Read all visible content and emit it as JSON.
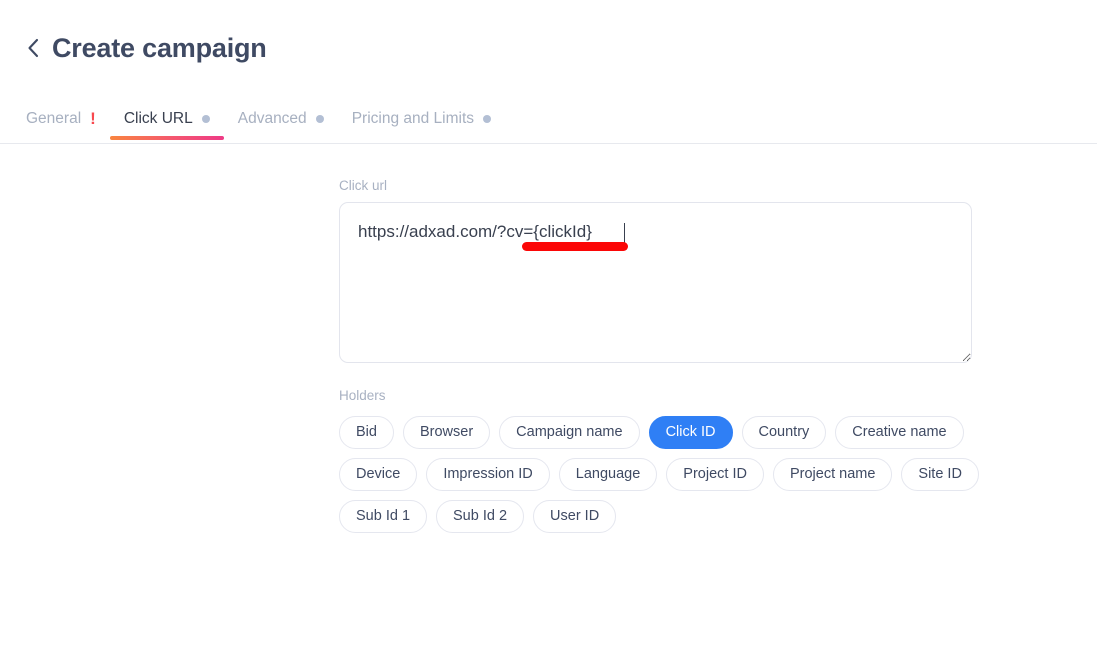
{
  "header": {
    "back_icon": "chevron-left-icon",
    "title": "Create campaign"
  },
  "tabs": [
    {
      "label": "General",
      "marker": "!",
      "marker_type": "alert",
      "active": false
    },
    {
      "label": "Click URL",
      "marker": "●",
      "marker_type": "dot",
      "active": true
    },
    {
      "label": "Advanced",
      "marker": "●",
      "marker_type": "dot",
      "active": false
    },
    {
      "label": "Pricing and Limits",
      "marker": "●",
      "marker_type": "dot",
      "active": false
    }
  ],
  "form": {
    "click_url": {
      "label": "Click url",
      "value": "https://adxad.com/?cv={clickId}",
      "placeholder": "Click url"
    },
    "holders": {
      "label": "Holders",
      "rows": [
        [
          "Bid",
          "Browser",
          "Campaign name",
          "Click ID",
          "Country",
          "Creative name"
        ],
        [
          "Device",
          "Impression ID",
          "Language",
          "Project ID",
          "Project name",
          "Site ID"
        ],
        [
          "Sub Id 1",
          "Sub Id 2",
          "User ID"
        ]
      ],
      "selected": "Click ID"
    }
  },
  "annotation": {
    "type": "red-underline",
    "target_text": "{clickId}",
    "color": "#fb0707"
  },
  "colors": {
    "accent_blue": "#2f7ff5",
    "tab_underline_from": "#f9853f",
    "tab_underline_to": "#ee3a86",
    "alert_red": "#f8484e",
    "muted_text": "#a8b1c2",
    "title_text": "#3f4a63"
  }
}
